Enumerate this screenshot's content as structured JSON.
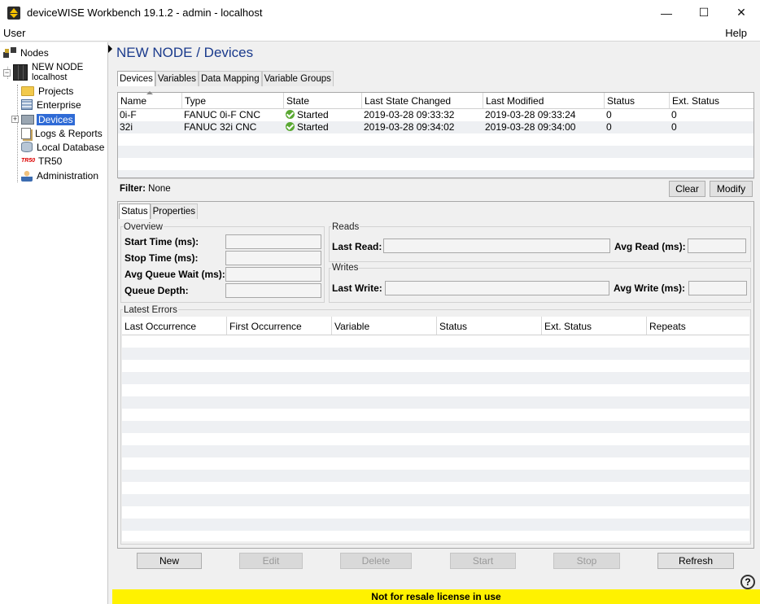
{
  "window": {
    "title": "deviceWISE Workbench 19.1.2  -  admin  -  localhost",
    "minimize": "—",
    "maximize": "☐",
    "close": "✕"
  },
  "menubar": {
    "user": "User",
    "help": "Help"
  },
  "tree": {
    "root": "Nodes",
    "node_name": "NEW NODE",
    "node_host": "localhost",
    "items": [
      {
        "label": "Projects",
        "icon": "folder-icon"
      },
      {
        "label": "Enterprise",
        "icon": "enterprise-icon"
      },
      {
        "label": "Devices",
        "icon": "devices-icon",
        "selected": true
      },
      {
        "label": "Logs & Reports",
        "icon": "logs-icon"
      },
      {
        "label": "Local Database",
        "icon": "database-icon"
      },
      {
        "label": "TR50",
        "icon": "tr50-icon"
      },
      {
        "label": "Administration",
        "icon": "admin-icon"
      }
    ],
    "tr50_badge": "TR50"
  },
  "main": {
    "title": "NEW NODE / Devices",
    "tabs": [
      "Devices",
      "Variables",
      "Data Mapping",
      "Variable Groups"
    ],
    "devices_table": {
      "columns": [
        "Name",
        "Type",
        "State",
        "Last State Changed",
        "Last Modified",
        "Status",
        "Ext. Status"
      ],
      "rows": [
        {
          "name": "0i-F",
          "type": "FANUC 0i-F CNC",
          "state": "Started",
          "last_state_changed": "2019-03-28 09:33:32",
          "last_modified": "2019-03-28 09:33:24",
          "status": "0",
          "ext_status": "0"
        },
        {
          "name": "32i",
          "type": "FANUC 32i CNC",
          "state": "Started",
          "last_state_changed": "2019-03-28 09:34:02",
          "last_modified": "2019-03-28 09:34:00",
          "status": "0",
          "ext_status": "0"
        }
      ]
    },
    "filter": {
      "label": "Filter:",
      "value": "None",
      "clear": "Clear",
      "modify": "Modify"
    },
    "detail_tabs": [
      "Status",
      "Properties"
    ],
    "overview": {
      "title": "Overview",
      "start_time": "Start Time (ms):",
      "stop_time": "Stop Time (ms):",
      "avg_queue_wait": "Avg Queue Wait (ms):",
      "queue_depth": "Queue Depth:"
    },
    "reads": {
      "title": "Reads",
      "last_read": "Last Read:",
      "avg_read": "Avg Read (ms):"
    },
    "writes": {
      "title": "Writes",
      "last_write": "Last Write:",
      "avg_write": "Avg Write (ms):"
    },
    "errors": {
      "title": "Latest Errors",
      "columns": [
        "Last Occurrence",
        "First Occurrence",
        "Variable",
        "Status",
        "Ext. Status",
        "Repeats"
      ]
    },
    "buttons": {
      "new": "New",
      "edit": "Edit",
      "delete": "Delete",
      "start": "Start",
      "stop": "Stop",
      "refresh": "Refresh"
    }
  },
  "status_bar": "Not for resale license in use",
  "help_icon": "?",
  "colors": {
    "selection": "#2f6bd6",
    "title": "#1a3a8c",
    "license_bar": "#fff200",
    "state_ok": "#5aa832"
  }
}
